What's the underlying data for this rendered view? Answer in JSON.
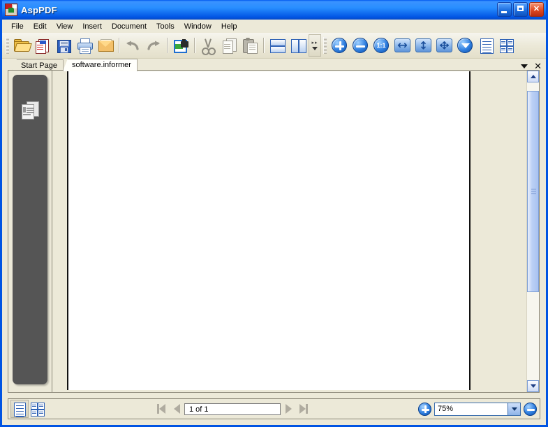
{
  "window": {
    "title": "AspPDF",
    "app_icon": "pdf-document-icon",
    "controls": {
      "minimize": "minimize-button",
      "maximize": "maximize-button",
      "close": "close-button"
    },
    "colors": {
      "titlebar_blue": "#0054e3",
      "window_face": "#ece9d8",
      "accent_blue": "#2f7fe0",
      "navpane_dark": "#555555"
    }
  },
  "menubar": {
    "items": [
      {
        "label": "File"
      },
      {
        "label": "Edit"
      },
      {
        "label": "View"
      },
      {
        "label": "Insert"
      },
      {
        "label": "Document"
      },
      {
        "label": "Tools"
      },
      {
        "label": "Window"
      },
      {
        "label": "Help"
      }
    ]
  },
  "toolbar": {
    "buttons": [
      {
        "name": "open-folder-icon",
        "tip": "Open"
      },
      {
        "name": "new-document-icon",
        "tip": "New"
      },
      {
        "name": "save-floppy-icon",
        "tip": "Save"
      },
      {
        "name": "print-icon",
        "tip": "Print"
      },
      {
        "name": "email-icon",
        "tip": "Email"
      },
      {
        "name": "undo-icon",
        "tip": "Undo"
      },
      {
        "name": "redo-icon",
        "tip": "Redo"
      },
      {
        "name": "insert-image-icon",
        "tip": "Insert Image"
      },
      {
        "name": "cut-icon",
        "tip": "Cut"
      },
      {
        "name": "copy-icon",
        "tip": "Copy"
      },
      {
        "name": "paste-icon",
        "tip": "Paste"
      },
      {
        "name": "layout-rows-icon",
        "tip": "Single Page Layout"
      },
      {
        "name": "layout-columns-icon",
        "tip": "Two Column Layout"
      },
      {
        "name": "toolbar-overflow-chevron-icon",
        "tip": "More Buttons"
      },
      {
        "name": "zoom-in-icon",
        "tip": "Zoom In"
      },
      {
        "name": "zoom-out-icon",
        "tip": "Zoom Out"
      },
      {
        "name": "actual-size-icon",
        "tip": "Actual Size",
        "label": "1:1"
      },
      {
        "name": "fit-width-icon",
        "tip": "Fit Width"
      },
      {
        "name": "fit-height-icon",
        "tip": "Fit Height"
      },
      {
        "name": "fit-page-icon",
        "tip": "Fit Page"
      },
      {
        "name": "rotate-view-icon",
        "tip": "Rotate View"
      },
      {
        "name": "text-lines-icon",
        "tip": "Text View"
      },
      {
        "name": "page-grid-icon",
        "tip": "Thumbnail Grid"
      }
    ]
  },
  "tabstrip": {
    "tabs": [
      {
        "label": "Start Page",
        "active": false
      },
      {
        "label": "software.informer",
        "active": true
      }
    ],
    "caret": "tab-list-caret-icon",
    "close": "close-tab-icon"
  },
  "navpane": {
    "icon": "pages-thumbnail-icon"
  },
  "document": {
    "page_background": "#ffffff"
  },
  "scrollbar": {
    "up": "scroll-up-arrow-icon",
    "down": "scroll-down-arrow-icon",
    "thumb": "scroll-thumb"
  },
  "statusbar": {
    "view_buttons": [
      {
        "name": "single-page-view-icon",
        "pressed": true
      },
      {
        "name": "thumbnail-view-icon",
        "pressed": false
      }
    ],
    "navigation": {
      "first": "first-page-icon",
      "prev": "previous-page-icon",
      "next": "next-page-icon",
      "last": "last-page-icon",
      "page_value": "1 of 1",
      "page_placeholder": "1 of 1"
    },
    "zoom": {
      "increase": "zoom-increase-icon",
      "decrease": "zoom-decrease-icon",
      "value": "75%",
      "placeholder": "75%",
      "caret": "zoom-dropdown-caret-icon"
    }
  }
}
